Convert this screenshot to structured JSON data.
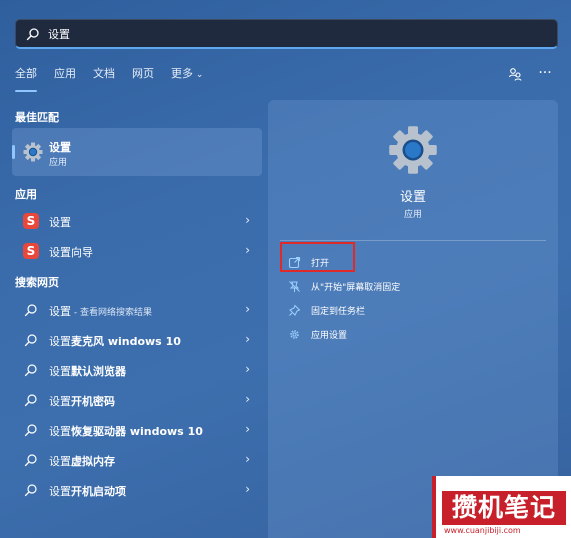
{
  "search": {
    "value": "设置"
  },
  "tabs": [
    {
      "label": "全部"
    },
    {
      "label": "应用"
    },
    {
      "label": "文档"
    },
    {
      "label": "网页"
    },
    {
      "label": "更多"
    }
  ],
  "best_match": {
    "heading": "最佳匹配",
    "title": "设置",
    "subtitle": "应用"
  },
  "apps": {
    "heading": "应用",
    "items": [
      {
        "label": "设置"
      },
      {
        "label": "设置向导"
      }
    ]
  },
  "web": {
    "heading": "搜索网页",
    "items": [
      {
        "prefix": "设置",
        "rest": " - 查看网络搜索结果"
      },
      {
        "prefix": "设置",
        "rest": "麦克风 windows 10"
      },
      {
        "prefix": "设置",
        "rest": "默认浏览器"
      },
      {
        "prefix": "设置",
        "rest": "开机密码"
      },
      {
        "prefix": "设置",
        "rest": "恢复驱动器 windows 10"
      },
      {
        "prefix": "设置",
        "rest": "虚拟内存"
      },
      {
        "prefix": "设置",
        "rest": "开机启动项"
      }
    ]
  },
  "panel": {
    "title": "设置",
    "subtitle": "应用",
    "actions": [
      {
        "label": "打开"
      },
      {
        "label": "从\"开始\"屏幕取消固定"
      },
      {
        "label": "固定到任务栏"
      },
      {
        "label": "应用设置"
      }
    ]
  },
  "watermark": {
    "text": "攒机笔记",
    "url": "www.cuanjibiji.com"
  }
}
